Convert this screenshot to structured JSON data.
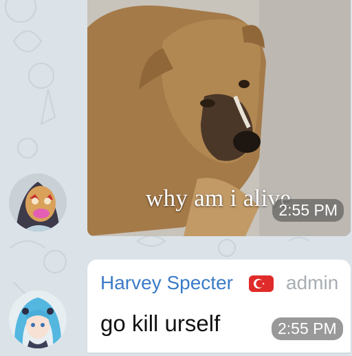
{
  "messages": [
    {
      "type": "photo",
      "caption": "why am i alive",
      "time": "2:55 PM",
      "photo_subject": "dog photo"
    },
    {
      "type": "text",
      "sender": "Harvey Specter",
      "sender_flag_icon": "turkey-flag-icon",
      "sender_role": "admin",
      "text": "go kill urself",
      "time": "2:55 PM"
    }
  ],
  "colors": {
    "wallpaper": "#dbe3e8",
    "sender_name": "#3b7bc7",
    "admin_badge": "#a7adb2",
    "bubble": "#ffffff",
    "time_pill": "#464646"
  }
}
